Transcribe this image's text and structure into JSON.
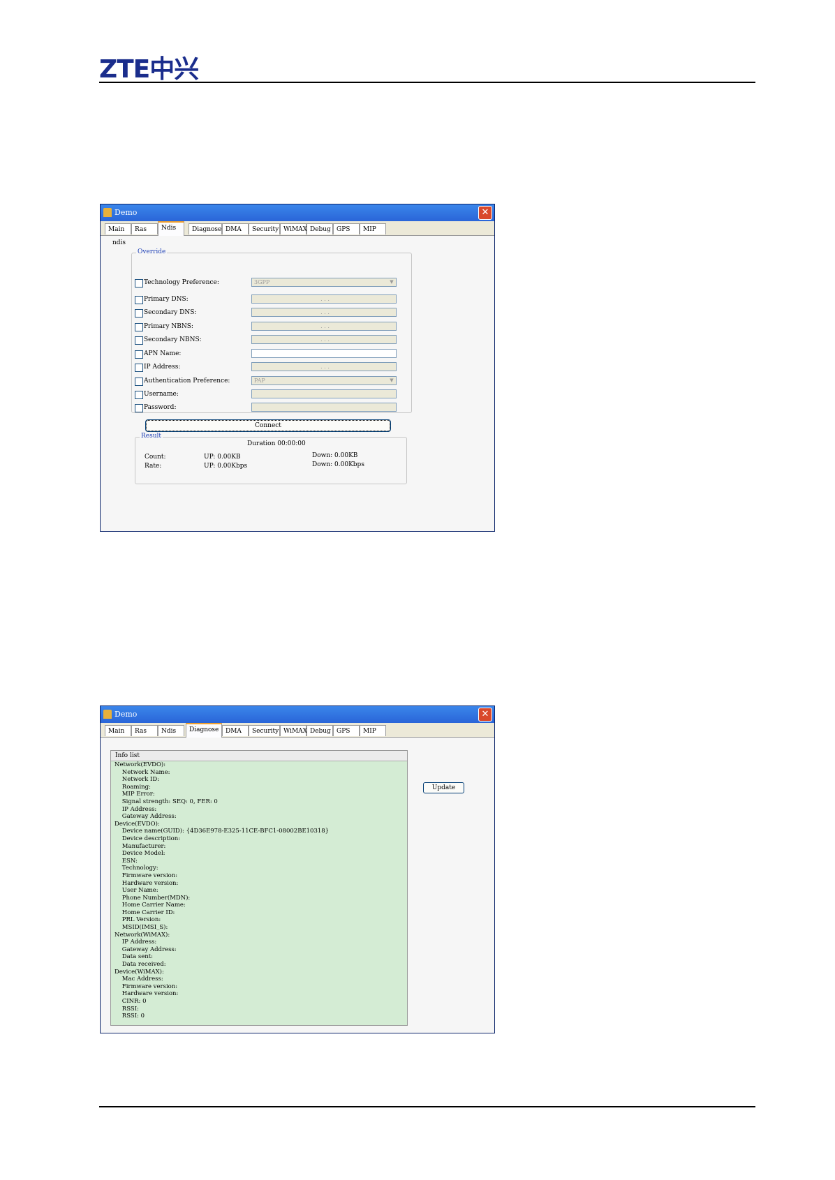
{
  "header": {
    "logo_text": "ZTE中兴"
  },
  "window1": {
    "title": "Demo",
    "close_glyph": "✕",
    "tabs": [
      "Main",
      "Ras",
      "Ndis",
      "Diagnose",
      "DMA",
      "Security",
      "WiMAX",
      "Debug",
      "GPS",
      "MIP"
    ],
    "active_tab": "Ndis",
    "section_label": "ndis",
    "override": {
      "title": "Override",
      "rows": [
        {
          "label": "Technology Preference:",
          "value": "3GPP",
          "kind": "combo"
        },
        {
          "label": "Primary DNS:",
          "value": ".    .    .",
          "kind": "ip"
        },
        {
          "label": "Secondary DNS:",
          "value": ".    .    .",
          "kind": "ip"
        },
        {
          "label": "Primary NBNS:",
          "value": ".    .    .",
          "kind": "ip"
        },
        {
          "label": "Secondary NBNS:",
          "value": ".    .    .",
          "kind": "ip"
        },
        {
          "label": "APN Name:",
          "value": "",
          "kind": "text"
        },
        {
          "label": "IP Address:",
          "value": ".    .    .",
          "kind": "ip"
        },
        {
          "label": "Authentication Preference:",
          "value": "PAP",
          "kind": "combo"
        },
        {
          "label": "Username:",
          "value": "",
          "kind": "text"
        },
        {
          "label": "Password:",
          "value": "",
          "kind": "text"
        }
      ]
    },
    "connect_label": "Connect",
    "result": {
      "title": "Result",
      "duration": "Duration 00:00:00",
      "count_label": "Count:",
      "rate_label": "Rate:",
      "count_up": "UP: 0.00KB",
      "rate_up": "UP: 0.00Kbps",
      "count_down": "Down: 0.00KB",
      "rate_down": "Down: 0.00Kbps"
    }
  },
  "window2": {
    "title": "Demo",
    "close_glyph": "✕",
    "tabs": [
      "Main",
      "Ras",
      "Ndis",
      "Diagnose",
      "DMA",
      "Security",
      "WiMAX",
      "Debug",
      "GPS",
      "MIP"
    ],
    "active_tab": "Diagnose",
    "info_list_header": "Info list",
    "update_label": "Update",
    "info_lines": [
      "Network(EVDO):",
      "    Network Name:",
      "    Network ID:",
      "    Roaming:",
      "    MIP Error:",
      "    Signal strength: SEQ: 0, FER: 0",
      "    IP Address:",
      "    Gateway Address:",
      "Device(EVDO):",
      "    Device name(GUID): {4D36E978-E325-11CE-BFC1-08002BE10318}",
      "    Device description:",
      "    Manufacturer:",
      "    Device Model:",
      "    ESN:",
      "    Technology:",
      "    Firmware version:",
      "    Hardware version:",
      "    User Name:",
      "    Phone Number(MDN):",
      "    Home Carrier Name:",
      "    Home Carrier ID:",
      "    PRL Version:",
      "    MSID(IMSI_S):",
      "Network(WiMAX):",
      "    IP Address:",
      "    Gateway Address:",
      "    Data sent:",
      "    Data received:",
      "Device(WiMAX):",
      "    Mac Address:",
      "    Firmware version:",
      "    Hardware version:",
      "    CINR: 0",
      "    RSSI:",
      "    RSSI: 0"
    ]
  }
}
